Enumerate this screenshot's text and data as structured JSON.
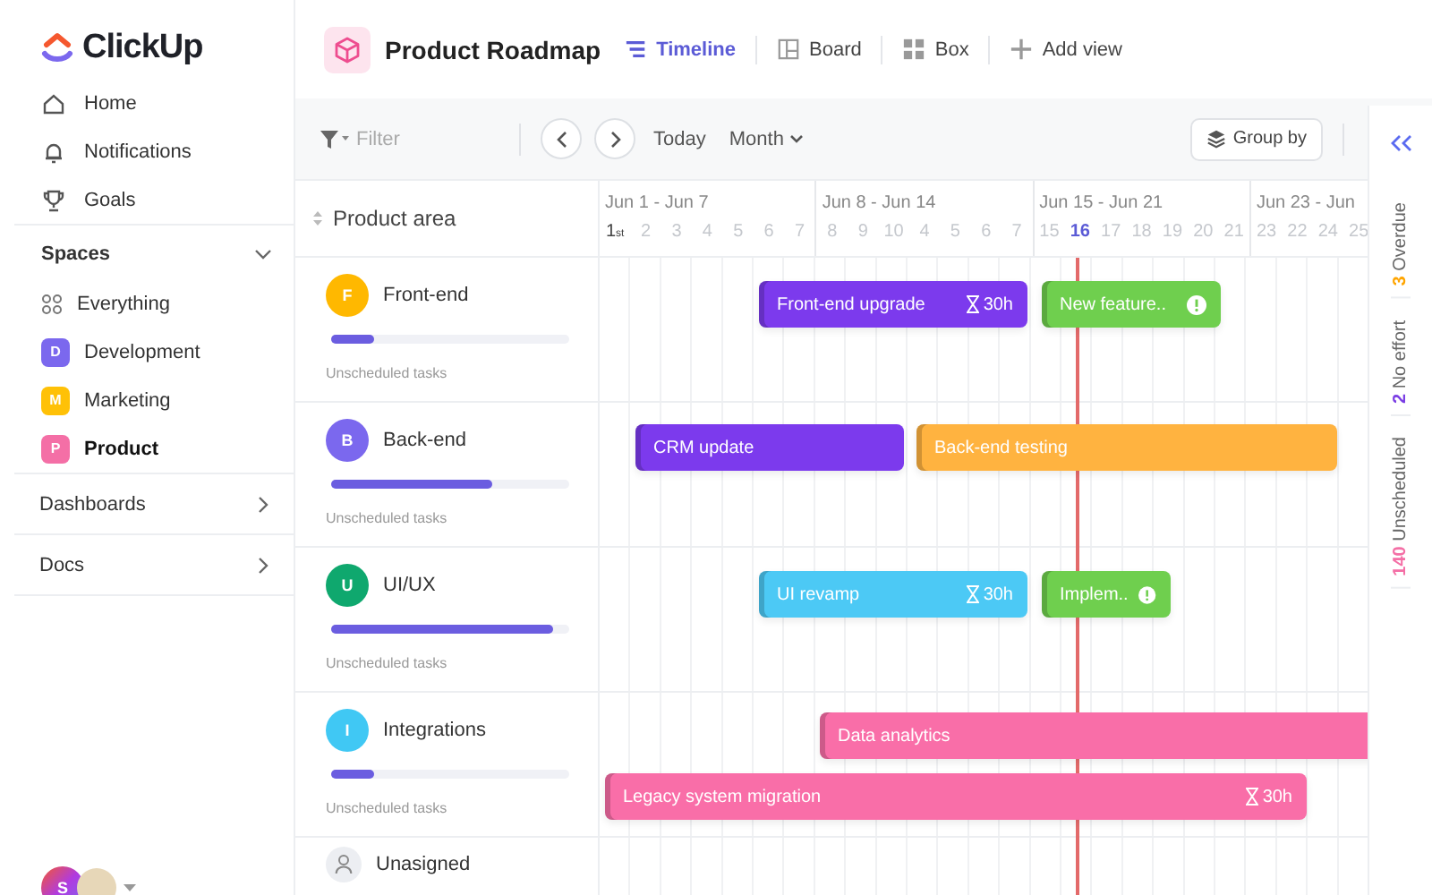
{
  "sidebar": {
    "logo": "ClickUp",
    "nav": [
      {
        "label": "Home",
        "kind": "home"
      },
      {
        "label": "Notifications",
        "kind": "bell"
      },
      {
        "label": "Goals",
        "kind": "trophy"
      }
    ],
    "spaces_title": "Spaces",
    "everything": "Everything",
    "spaces": [
      {
        "letter": "D",
        "label": "Development",
        "color": "#7b68ee",
        "selected": false
      },
      {
        "letter": "M",
        "label": "Marketing",
        "color": "#ffc107",
        "selected": false
      },
      {
        "letter": "P",
        "label": "Product",
        "color": "#f46fa6",
        "selected": true
      }
    ],
    "sections": [
      "Dashboards",
      "Docs"
    ],
    "user_initial": "S"
  },
  "header": {
    "title": "Product Roadmap",
    "views": [
      {
        "label": "Timeline",
        "kind": "timeline",
        "selected": true
      },
      {
        "label": "Board",
        "kind": "board",
        "selected": false
      },
      {
        "label": "Box",
        "kind": "box",
        "selected": false
      },
      {
        "label": "Add view",
        "kind": "add",
        "selected": false
      }
    ]
  },
  "toolbar": {
    "filter_placeholder": "Filter",
    "today": "Today",
    "range": "Month",
    "group_by": "Group by"
  },
  "timeline": {
    "column_title": "Product area",
    "weeks": [
      {
        "label": "Jun 1 - Jun 7",
        "days": [
          {
            "label": "1$_{st}$",
            "today": false
          },
          {
            "label": "2",
            "today": false
          },
          {
            "label": "3",
            "today": false
          },
          {
            "label": "4",
            "today": false
          },
          {
            "label": "5",
            "today": false
          },
          {
            "label": "6",
            "today": false
          },
          {
            "label": "7",
            "today": false
          }
        ]
      },
      {
        "label": "Jun 8 - Jun 14",
        "days": [
          {
            "label": "8",
            "today": false
          },
          {
            "label": "9",
            "today": false
          },
          {
            "label": "10",
            "today": false
          },
          {
            "label": "4",
            "today": false
          },
          {
            "label": "5",
            "today": false
          },
          {
            "label": "6",
            "today": false
          },
          {
            "label": "7",
            "today": false
          }
        ]
      },
      {
        "label": "Jun 15 - Jun 21",
        "days": [
          {
            "label": "15",
            "today": false
          },
          {
            "label": "16",
            "today": true
          },
          {
            "label": "17",
            "today": false
          },
          {
            "label": "18",
            "today": false
          },
          {
            "label": "19",
            "today": false
          },
          {
            "label": "20",
            "today": false
          },
          {
            "label": "21",
            "today": false
          }
        ]
      },
      {
        "label": "Jun 23 - Jun",
        "days": [
          {
            "label": "23",
            "today": false
          },
          {
            "label": "22",
            "today": false
          },
          {
            "label": "24",
            "today": false
          },
          {
            "label": "25",
            "today": false
          }
        ]
      }
    ],
    "groups": [
      {
        "name": "Front-end",
        "letter": "F",
        "color": "#ffb800",
        "level": 0.18,
        "caption": "Unscheduled tasks",
        "bars": [
          {
            "label": "Front-end upgrade",
            "effort": "30h",
            "warning": false,
            "color": "#7c3aed"
          },
          {
            "label": "New feature..",
            "warning": true,
            "color": "#6fcf4e"
          }
        ]
      },
      {
        "name": "Back-end",
        "letter": "B",
        "color": "#7b68ee",
        "level": 0.68,
        "caption": "Unscheduled tasks",
        "bars": [
          {
            "label": "CRM update",
            "warning": false,
            "color": "#7c3aed"
          },
          {
            "label": "Back-end testing",
            "warning": false,
            "color": "#ffb340"
          }
        ]
      },
      {
        "name": "UI/UX",
        "letter": "U",
        "color": "#0fa86e",
        "level": 0.93,
        "caption": "Unscheduled tasks",
        "bars": [
          {
            "label": "UI revamp",
            "effort": "30h",
            "warning": false,
            "color": "#4cc9f5"
          },
          {
            "label": "Implem..",
            "warning": true,
            "color": "#6fcf4e"
          }
        ]
      },
      {
        "name": "Integrations",
        "letter": "I",
        "color": "#40c8f4",
        "level": 0.18,
        "caption": "Unscheduled tasks",
        "bars": [
          {
            "label": "Data analytics",
            "warning": false,
            "color": "#f96ea8"
          },
          {
            "label": "Legacy system migration",
            "effort": "30h",
            "warning": false,
            "color": "#f96ea8"
          }
        ]
      },
      {
        "name": "Unasigned",
        "kind": "unassigned"
      }
    ]
  },
  "side_panel": [
    {
      "count": "3",
      "label": "Overdue",
      "color": "#ffa500"
    },
    {
      "count": "2",
      "label": "No effort",
      "color": "#7b3fe4"
    },
    {
      "count": "140",
      "label": "Unscheduled",
      "color": "#f46fa6"
    }
  ]
}
